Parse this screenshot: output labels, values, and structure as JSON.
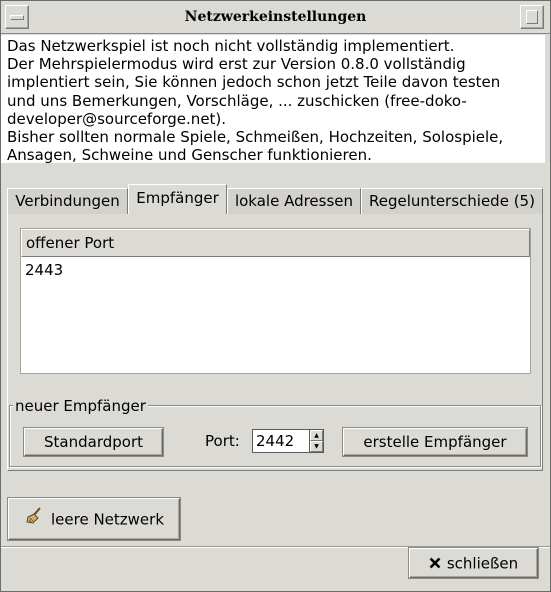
{
  "window": {
    "title": "Netzwerkeinstellungen"
  },
  "info": {
    "lines": [
      "Das Netzwerkspiel ist noch nicht vollständig implementiert.",
      "Der Mehrspielermodus wird erst zur Version 0.8.0 vollständig",
      "implentiert sein, Sie können jedoch schon jetzt Teile davon testen",
      "und uns Bemerkungen, Vorschläge, ... zuschicken (free-doko-",
      "developer@sourceforge.net).",
      "Bisher sollten normale Spiele, Schmeißen, Hochzeiten, Solospiele,",
      "Ansagen, Schweine und Genscher funktionieren."
    ]
  },
  "tabs": [
    {
      "label": "Verbindungen",
      "active": false
    },
    {
      "label": "Empfänger",
      "active": true
    },
    {
      "label": "lokale Adressen",
      "active": false
    },
    {
      "label": "Regelunterschiede (5)",
      "active": false
    }
  ],
  "receivers": {
    "column_header": "offener Port",
    "rows": [
      "2443"
    ]
  },
  "new_receiver": {
    "group_label": "neuer Empfänger",
    "default_port_button": "Standardport",
    "port_label": "Port:",
    "port_value": "2442",
    "create_button": "erstelle Empfänger"
  },
  "footer": {
    "clear_network_button": "leere Netzwerk",
    "close_button": "schließen"
  },
  "icons": {
    "clear": "broom-icon",
    "close": "x-icon"
  }
}
